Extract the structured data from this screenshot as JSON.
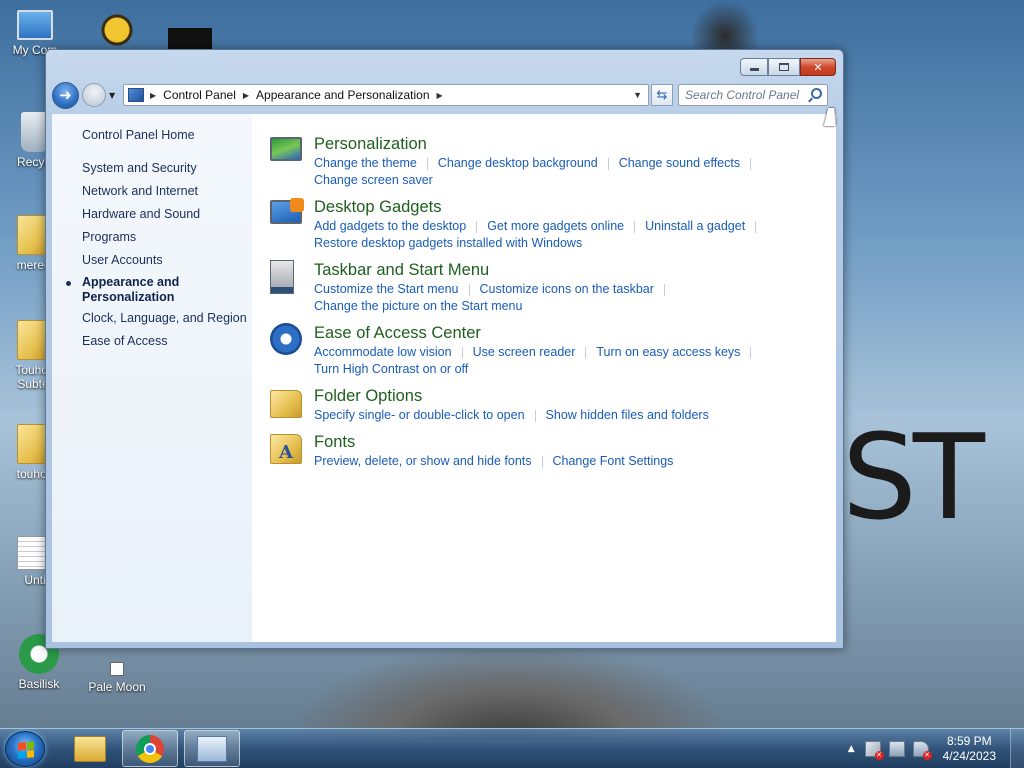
{
  "desktop": {
    "icons": [
      {
        "label": "My Com",
        "kind": "pc-icon"
      },
      {
        "label": "",
        "kind": "bee-icon"
      },
      {
        "label": "",
        "kind": "black-window-icon"
      },
      {
        "label": "Recycl",
        "kind": "recycle-bin-icon"
      },
      {
        "label": "meredi",
        "kind": "folder-icon"
      },
      {
        "label": "Touhou",
        "label2": "Subter",
        "kind": "folder-icon"
      },
      {
        "label": "touhou",
        "kind": "folder-icon"
      },
      {
        "label": "Unti",
        "kind": "document-icon"
      },
      {
        "label": "Basilisk",
        "kind": "basilisk-icon"
      },
      {
        "label": "Pale Moon",
        "kind": "pale-moon-icon"
      }
    ],
    "wallpaper_text": "ST"
  },
  "window": {
    "address": {
      "crumbs": [
        "Control Panel",
        "Appearance and Personalization"
      ]
    },
    "search": {
      "placeholder": "Search Control Panel"
    },
    "left_pane": {
      "home": "Control Panel Home",
      "items": [
        {
          "label": "System and Security",
          "selected": false
        },
        {
          "label": "Network and Internet",
          "selected": false
        },
        {
          "label": "Hardware and Sound",
          "selected": false
        },
        {
          "label": "Programs",
          "selected": false
        },
        {
          "label": "User Accounts",
          "selected": false
        },
        {
          "label": "Appearance and",
          "label2": "Personalization",
          "selected": true
        },
        {
          "label": "Clock, Language, and Region",
          "selected": false
        },
        {
          "label": "Ease of Access",
          "selected": false
        }
      ]
    },
    "categories": [
      {
        "title": "Personalization",
        "icon": "personalization-icon",
        "row1": [
          "Change the theme",
          "Change desktop background",
          "Change sound effects"
        ],
        "row2": [
          "Change screen saver"
        ]
      },
      {
        "title": "Desktop Gadgets",
        "icon": "gadgets-icon",
        "row1": [
          "Add gadgets to the desktop",
          "Get more gadgets online",
          "Uninstall a gadget"
        ],
        "row2": [
          "Restore desktop gadgets installed with Windows"
        ]
      },
      {
        "title": "Taskbar and Start Menu",
        "icon": "taskbar-icon",
        "row1": [
          "Customize the Start menu",
          "Customize icons on the taskbar"
        ],
        "row2": [
          "Change the picture on the Start menu"
        ]
      },
      {
        "title": "Ease of Access Center",
        "icon": "ease-of-access-icon",
        "row1": [
          "Accommodate low vision",
          "Use screen reader",
          "Turn on easy access keys"
        ],
        "row2": [
          "Turn High Contrast on or off"
        ]
      },
      {
        "title": "Folder Options",
        "icon": "folder-options-icon",
        "row1": [
          "Specify single- or double-click to open",
          "Show hidden files and folders"
        ],
        "row2": []
      },
      {
        "title": "Fonts",
        "icon": "fonts-icon",
        "row1": [
          "Preview, delete, or show and hide fonts",
          "Change Font Settings"
        ],
        "row2": []
      }
    ]
  },
  "taskbar": {
    "clock_time": "8:59 PM",
    "clock_date": "4/24/2023",
    "pinned": [
      "file-explorer-icon",
      "chrome-icon",
      "control-panel-icon"
    ]
  }
}
